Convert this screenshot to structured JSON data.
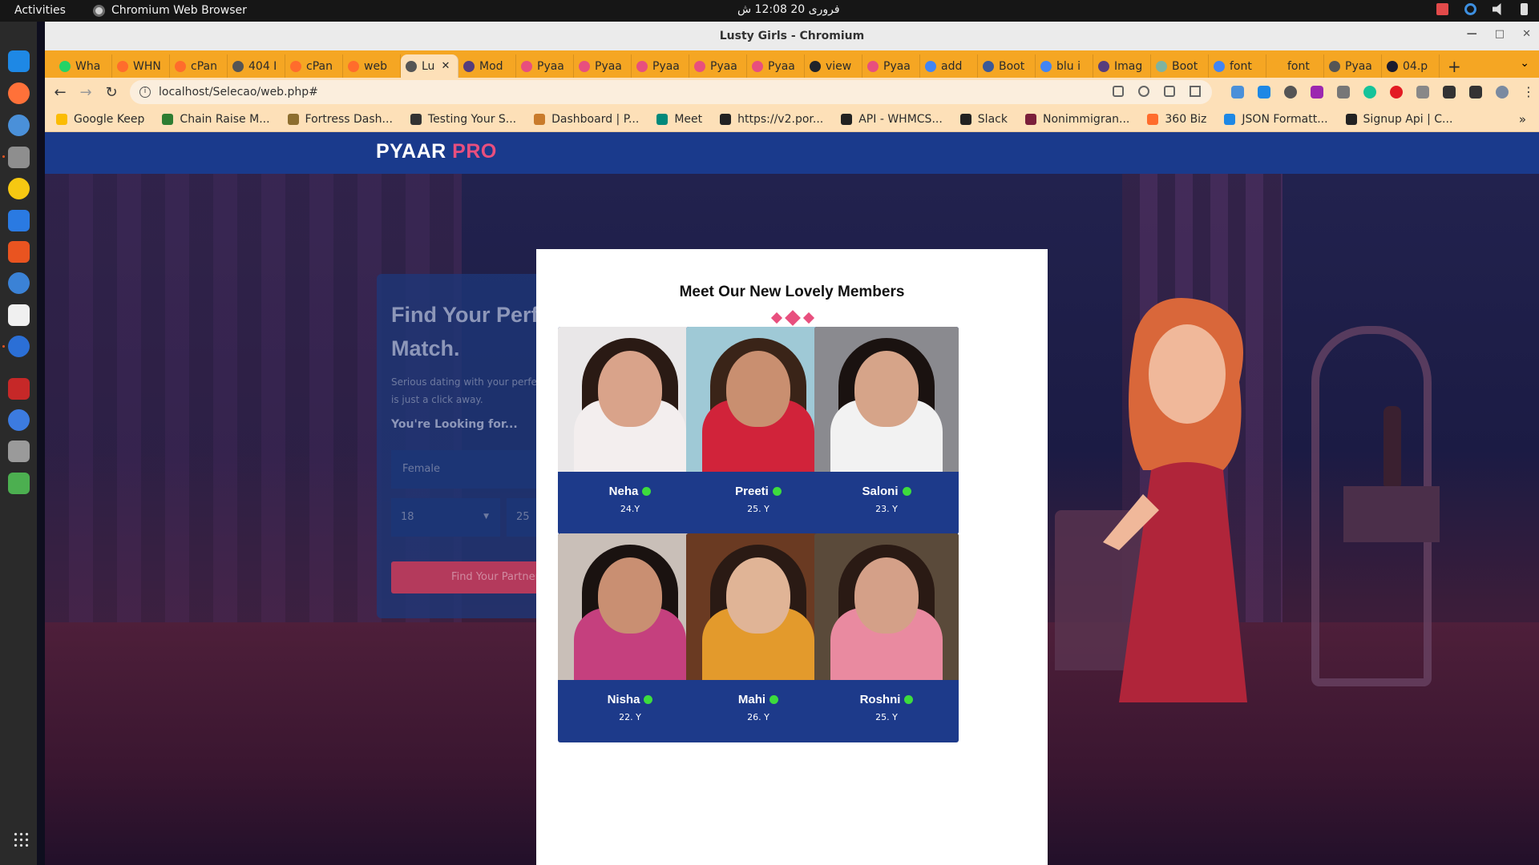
{
  "system": {
    "activities": "Activities",
    "app_name": "Chromium Web Browser",
    "clock": "فروری 20  12:08 ش"
  },
  "browser": {
    "window_title": "Lusty Girls - Chromium",
    "tabs": [
      {
        "label": "Wha",
        "color": "#25d366"
      },
      {
        "label": "WHN",
        "color": "#ff6c2c"
      },
      {
        "label": "cPan",
        "color": "#ff6c2c"
      },
      {
        "label": "404 I",
        "color": "#555555"
      },
      {
        "label": "cPan",
        "color": "#ff6c2c"
      },
      {
        "label": "web",
        "color": "#ff6c2c"
      },
      {
        "label": "Lu",
        "color": "#555555",
        "active": true
      },
      {
        "label": "Mod",
        "color": "#563d7c"
      },
      {
        "label": "Pyaa",
        "color": "#e84f7e"
      },
      {
        "label": "Pyaa",
        "color": "#e84f7e"
      },
      {
        "label": "Pyaa",
        "color": "#e84f7e"
      },
      {
        "label": "Pyaa",
        "color": "#e84f7e"
      },
      {
        "label": "Pyaa",
        "color": "#e84f7e"
      },
      {
        "label": "view",
        "color": "#20232a"
      },
      {
        "label": "Pyaa",
        "color": "#e84f7e"
      },
      {
        "label": "add",
        "color": "#4285f4"
      },
      {
        "label": "Boot",
        "color": "#3b5998"
      },
      {
        "label": "blu i",
        "color": "#4285f4"
      },
      {
        "label": "Imag",
        "color": "#563d7c"
      },
      {
        "label": "Boot",
        "color": "#7fb3a0"
      },
      {
        "label": "font",
        "color": "#4285f4"
      },
      {
        "label": "font",
        "color": "#f5a623"
      },
      {
        "label": "Pyaa",
        "color": "#555555"
      },
      {
        "label": "04.p",
        "color": "#1a1a2e"
      }
    ],
    "new_tab": "+",
    "url": "localhost/Selecao/web.php#",
    "bookmarks": [
      {
        "label": "Google Keep",
        "color": "#fbbc04"
      },
      {
        "label": "Chain Raise M...",
        "color": "#2e7d32"
      },
      {
        "label": "Fortress Dash...",
        "color": "#8d6e2f"
      },
      {
        "label": "Testing Your S...",
        "color": "#333333"
      },
      {
        "label": "Dashboard | P...",
        "color": "#c97b2b"
      },
      {
        "label": "Meet",
        "color": "#00897b"
      },
      {
        "label": "https://v2.por...",
        "color": "#222222"
      },
      {
        "label": "API - WHMCS...",
        "color": "#222222"
      },
      {
        "label": "Slack",
        "color": "#222222"
      },
      {
        "label": "Nonimmigran...",
        "color": "#7b1f3a"
      },
      {
        "label": "360 Biz",
        "color": "#ff6c2c"
      },
      {
        "label": "JSON Formatt...",
        "color": "#1e88e5"
      },
      {
        "label": "Signup Api | C...",
        "color": "#222222"
      }
    ]
  },
  "site": {
    "logo_main": "PYAAR",
    "logo_accent": "PRO",
    "hero_title": "Find Your Perfect Match.",
    "hero_subtitle": "Serious dating with your perfect match is just a click away.",
    "looking_for": "You're Looking for...",
    "gender_value": "Female",
    "age_from": "18",
    "age_to": "25",
    "find_button": "Find Your Partner"
  },
  "modal": {
    "title": "Meet Our New Lovely Members",
    "members": [
      {
        "name": "Neha",
        "age": "24.Y",
        "bg": "#e9e7e8",
        "skin": "#d9a38a",
        "hair": "#2a1a14",
        "outfit": "#f3eeee"
      },
      {
        "name": "Preeti",
        "age": "25. Y",
        "bg": "#9fc9d6",
        "skin": "#c98f70",
        "hair": "#3a2418",
        "outfit": "#d1233a"
      },
      {
        "name": "Saloni",
        "age": "23. Y",
        "bg": "#8a8a8f",
        "skin": "#d6a489",
        "hair": "#1a1210",
        "outfit": "#f2f2f2"
      },
      {
        "name": "Nisha",
        "age": "22. Y",
        "bg": "#c9bfb8",
        "skin": "#c98f72",
        "hair": "#1a1210",
        "outfit": "#c5407e"
      },
      {
        "name": "Mahi",
        "age": "26. Y",
        "bg": "#6a3a22",
        "skin": "#e0b496",
        "hair": "#2a1a14",
        "outfit": "#e39a2c"
      },
      {
        "name": "Roshni",
        "age": "25. Y",
        "bg": "#5a4a3a",
        "skin": "#d4a088",
        "hair": "#2a1a14",
        "outfit": "#e98aa0"
      }
    ]
  }
}
